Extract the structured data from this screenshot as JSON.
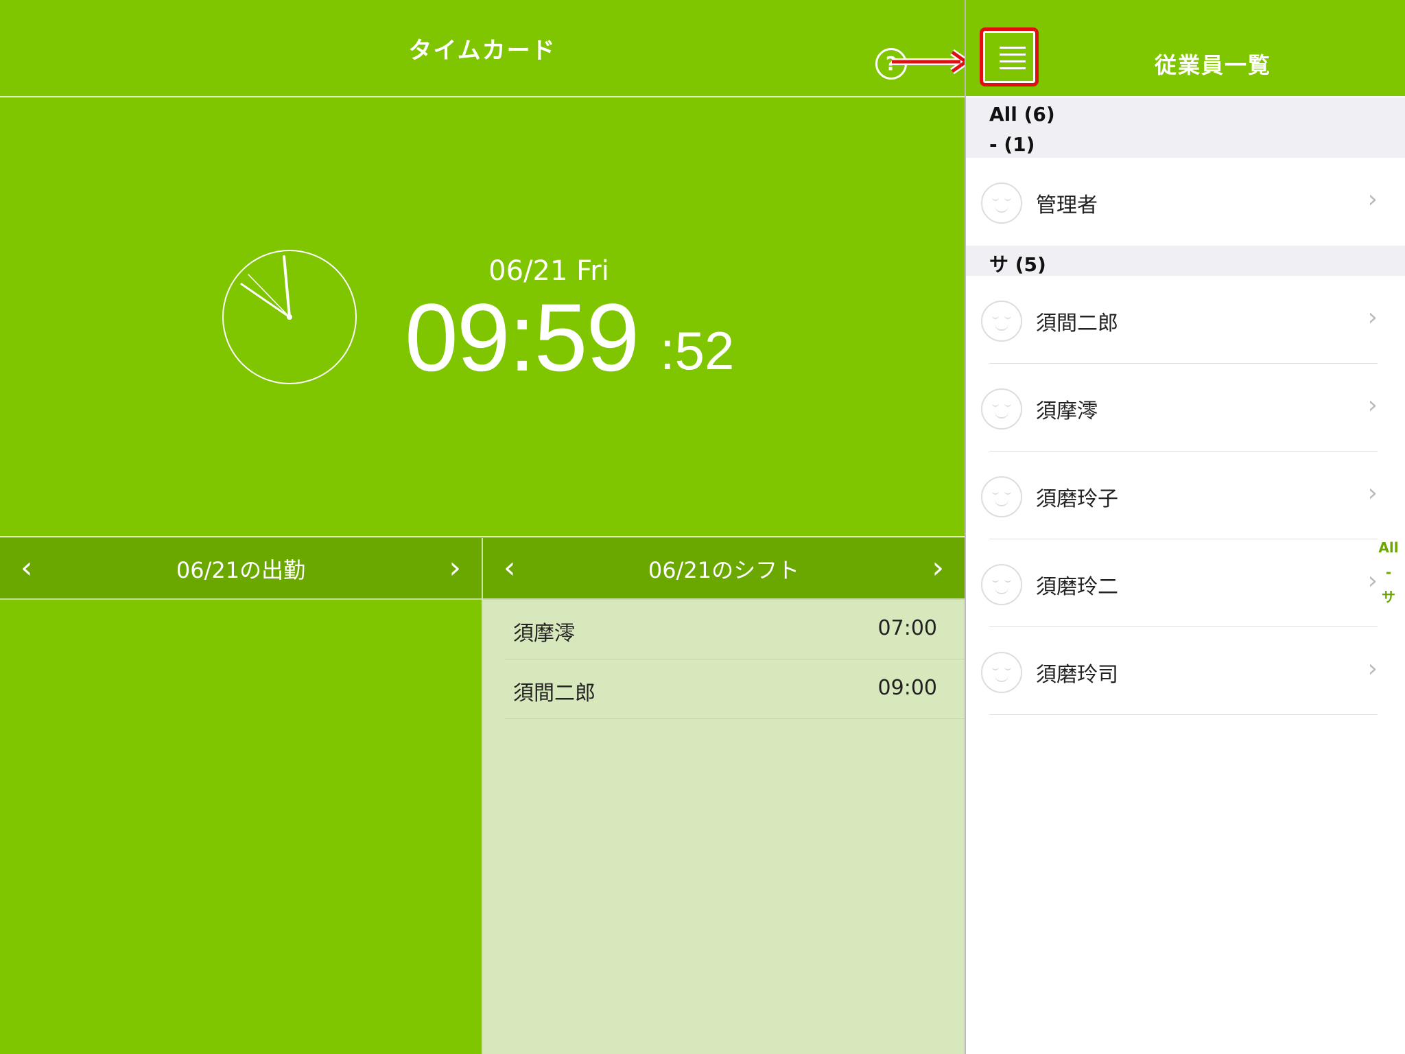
{
  "timecard": {
    "title": "タイムカード",
    "help_label": "?",
    "date": "06/21 Fri",
    "time": "09:59",
    "seconds": ":52",
    "attendance": {
      "title": "06/21の出勤",
      "prev": "‹",
      "next": "›"
    },
    "shift": {
      "title": "06/21のシフト",
      "prev": "‹",
      "next": "›",
      "rows": [
        {
          "name": "須摩澪",
          "time": "07:00"
        },
        {
          "name": "須間二郎",
          "time": "09:00"
        }
      ]
    }
  },
  "employees": {
    "title": "従業員一覧",
    "all_label": "All (6)",
    "sections": [
      {
        "label": "- (1)",
        "items": [
          "管理者"
        ]
      },
      {
        "label": "サ (5)",
        "items": [
          "須間二郎",
          "須摩澪",
          "須磨玲子",
          "須磨玲二",
          "須磨玲司"
        ]
      }
    ],
    "chevron": "›",
    "index": [
      "All",
      "-",
      "サ"
    ]
  },
  "colors": {
    "green": "#7fc600",
    "dark_green": "#6aa800",
    "highlight": "#e01010"
  }
}
